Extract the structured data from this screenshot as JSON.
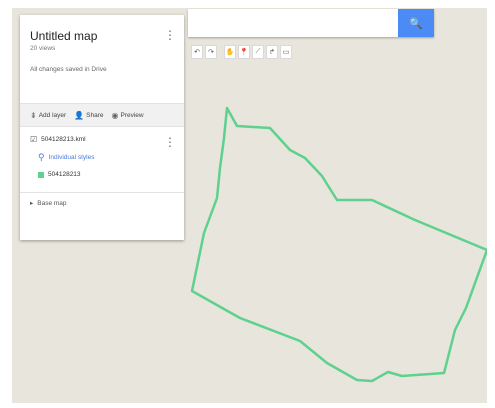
{
  "panel": {
    "title": "Untitled map",
    "views": "20 views",
    "saved_status": "All changes saved in Drive",
    "actions": {
      "add_layer": "Add layer",
      "share": "Share",
      "preview": "Preview"
    },
    "layer": {
      "name": "504128213.kml",
      "style_link": "Individual styles",
      "feature": "504128213"
    },
    "base_map": "Base map"
  },
  "search": {
    "placeholder": ""
  },
  "map": {
    "boundary_color": "#5dd18d"
  },
  "icons": {
    "search": "search-icon",
    "undo": "undo-icon",
    "redo": "redo-icon",
    "hand": "hand-icon",
    "marker": "marker-icon",
    "draw_line": "draw-line-icon",
    "directions": "directions-icon",
    "ruler": "ruler-icon"
  }
}
